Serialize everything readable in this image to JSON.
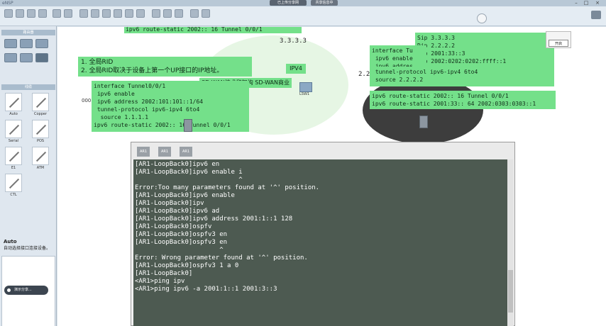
{
  "titlebar": {
    "app_name": "eNSP",
    "pill_1": "已上传分享网",
    "pill_2": "共享信息中",
    "min": "–",
    "max": "□",
    "close": "×"
  },
  "left_panel": {
    "routers_head": "路由器",
    "cables_head": "线缆",
    "cables": [
      {
        "label": "Auto"
      },
      {
        "label": "Copper"
      },
      {
        "label": "Serial"
      },
      {
        "label": "POS"
      },
      {
        "label": "E1"
      },
      {
        "label": "ATM"
      },
      {
        "label": "CTL"
      }
    ],
    "auto_title": "Auto",
    "auto_desc": "自动选择接口连接设备。",
    "share_button": "演示分享..."
  },
  "canvas": {
    "top_line": "ipv6 route-static 2002:: 16 Tunnel 0/0/1",
    "lb_333": "3.3.3.3",
    "note_lines": [
      "1. 全局RID",
      "2. 全局RID取决于设备上第一个UP接口的IP地址。"
    ],
    "ipv4_label": "IPV4",
    "lb_22": "2.2",
    "sdwan_note": "SD-WAN技术和架构 SD-WAN商业行为",
    "device_label": "LSW1",
    "left_config": [
      "interface Tunnel0/0/1",
      " ipv6 enable",
      " ipv6 address 2002:101:101::1/64",
      " tunnel-protocol ipv6-ipv4 6to4",
      "  source 1.1.1.1",
      "ipv6 route-static 2002:: 16 Tunnel 0/0/1"
    ],
    "left_prefix": "000",
    "right_top": [
      "Sip 3.3.3.3",
      "Dip 2.2.2.2",
      "Sip 2001:33::3",
      "Dip 2002:0202:0202:ffff::1"
    ],
    "right_config": [
      "interface Tu",
      " ipv6 enable",
      " ipv6 addres",
      " tunnel-protocol ipv6-ipv4 6to4",
      " source 2.2.2.2"
    ],
    "right_routes": [
      "ipv6 route-static 2002:: 16 Tunnel 0/0/1",
      "ipv6 route-static 2001:33:: 64 2002:0303:0303::1"
    ],
    "mini_btn": "开启"
  },
  "terminal": {
    "tabs": [
      "AR1",
      "AR1",
      "AR1"
    ],
    "lines": [
      "[AR1-LoopBack0]ipv6 en",
      "[AR1-LoopBack0]ipv6 enable i",
      "                           ^",
      "Error:Too many parameters found at '^' position.",
      "[AR1-LoopBack0]ipv6 enable",
      "[AR1-LoopBack0]ipv",
      "[AR1-LoopBack0]ipv6 ad",
      "[AR1-LoopBack0]ipv6 address 2001:1::1 128",
      "[AR1-LoopBack0]ospfv",
      "[AR1-LoopBack0]ospfv3 en",
      "[AR1-LoopBack0]ospfv3 en",
      "                      ^",
      "Error: Wrong parameter found at '^' position.",
      "[AR1-LoopBack0]ospfv3 1 a 0",
      "[AR1-LoopBack0]",
      "<AR1>ping ipv",
      "<AR1>ping ipv6 -a 2001:1::1 2001:3::3"
    ]
  }
}
